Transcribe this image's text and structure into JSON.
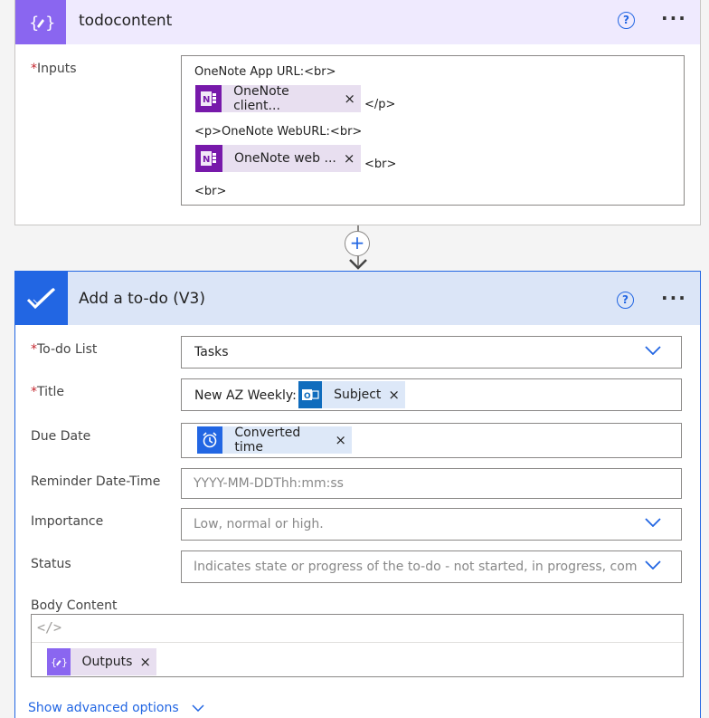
{
  "compose": {
    "title": "todocontent",
    "help": "?",
    "more": "···",
    "inputs_label": "Inputs",
    "required_mark": "*",
    "line1": "OneNote App URL:<br>",
    "token1": "OneNote client...",
    "after_token1": "</p>",
    "line2": "<p>OneNote WebURL:<br>",
    "token2": "OneNote web ...",
    "after_token2": "<br>",
    "line3": "<br>",
    "token_remove": "×"
  },
  "connector": {
    "plus": "+"
  },
  "todo": {
    "title": "Add a to-do (V3)",
    "help": "?",
    "more": "···",
    "required_mark": "*",
    "fields": {
      "list": {
        "label": "To-do List",
        "value": "Tasks"
      },
      "title": {
        "label": "Title",
        "prefix": "New AZ Weekly:",
        "token": "Subject"
      },
      "due": {
        "label": "Due Date",
        "token": "Converted time"
      },
      "reminder": {
        "label": "Reminder Date-Time",
        "placeholder": "YYYY-MM-DDThh:mm:ss"
      },
      "importance": {
        "label": "Importance",
        "placeholder": "Low, normal or high."
      },
      "status": {
        "label": "Status",
        "placeholder": "Indicates state or progress of the to-do - not started, in progress, completed"
      },
      "body": {
        "label": "Body Content",
        "code_icon": "</>",
        "token": "Outputs"
      }
    },
    "token_remove": "×",
    "advanced": "Show advanced options"
  },
  "colors": {
    "compose_accent": "#8a66f0",
    "todo_accent": "#2266e3",
    "onenote": "#7719aa",
    "outlook": "#0f6cbd"
  }
}
